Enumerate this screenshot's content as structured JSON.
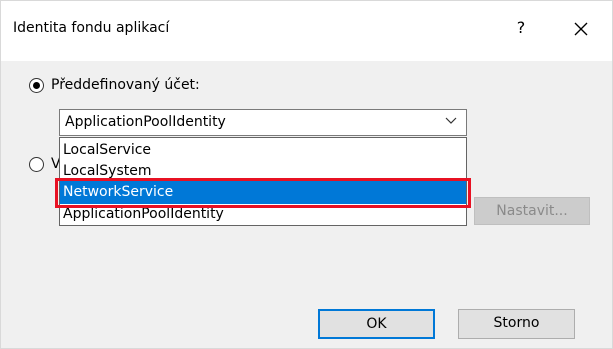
{
  "dialog": {
    "title": "Identita fondu aplikací",
    "help_label": "?",
    "close_label": "✕"
  },
  "predefined": {
    "label": "Předdefinovaný účet:",
    "selected": true
  },
  "custom": {
    "label_fragment": "V",
    "selected": false
  },
  "account_select": {
    "value": "ApplicationPoolIdentity",
    "expanded": true,
    "options": [
      "LocalService",
      "LocalSystem",
      "NetworkService",
      "ApplicationPoolIdentity"
    ],
    "highlighted_option": "NetworkService"
  },
  "set_button": {
    "label": "Nastavit...",
    "enabled": false
  },
  "buttons": {
    "ok": "OK",
    "cancel": "Storno"
  },
  "colors": {
    "selection": "#0078d7",
    "annotation_frame": "#e81123",
    "content_background": "#f0f0f0"
  }
}
